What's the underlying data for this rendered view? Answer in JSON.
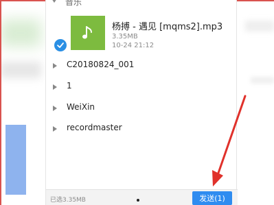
{
  "file_list": {
    "group_title": "音乐",
    "selected_file": {
      "name": "杨搏 - 遇见 [mqms2].mp3",
      "size": "3.35MB",
      "date": "10-24 21:12",
      "selected": true
    },
    "folders": [
      {
        "label": "C20180824_001"
      },
      {
        "label": "1"
      },
      {
        "label": "WeiXin"
      },
      {
        "label": "recordmaster"
      }
    ]
  },
  "bottom_bar": {
    "selected_summary": "已选3.35MB",
    "send_label": "发送(1)"
  },
  "colors": {
    "accent": "#2f8cf0",
    "check": "#2a8fe4",
    "music_thumb": "#7dbb3f",
    "annotation_arrow": "#e0312b"
  }
}
